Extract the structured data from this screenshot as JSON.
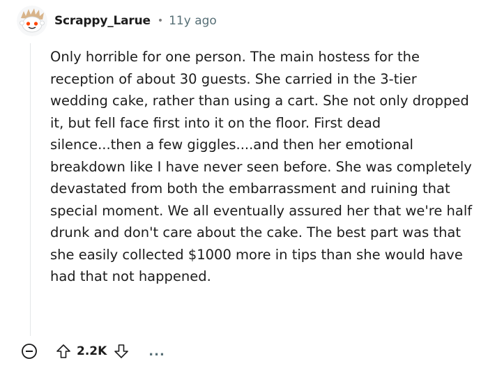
{
  "comment": {
    "author": "Scrappy_Larue",
    "separator": "•",
    "age": "11y ago",
    "body": "Only horrible for one person. The main hostess for the reception of about 30 guests. She carried in the 3-tier wedding cake, rather than using a cart. She not only dropped it, but fell face first into it on the floor. First dead silence...then a few giggles....and then her emotional breakdown like I have never seen before. She was completely devastated from both the embarrassment and ruining that special moment. We all eventually assured her that we're half drunk and don't care about the cake. The best part was that she easily collected $1000 more in tips than she would have had that not happened.",
    "score": "2.2K",
    "more_label": "..."
  },
  "icons": {
    "avatar": "snoo-avatar-icon",
    "collapse": "collapse-minus-icon",
    "upvote": "upvote-arrow-icon",
    "downvote": "downvote-arrow-icon",
    "more": "more-options-icon"
  },
  "colors": {
    "brand": "#ff4500",
    "meta_text": "#576f76",
    "thread_line": "#e4e6e8"
  }
}
